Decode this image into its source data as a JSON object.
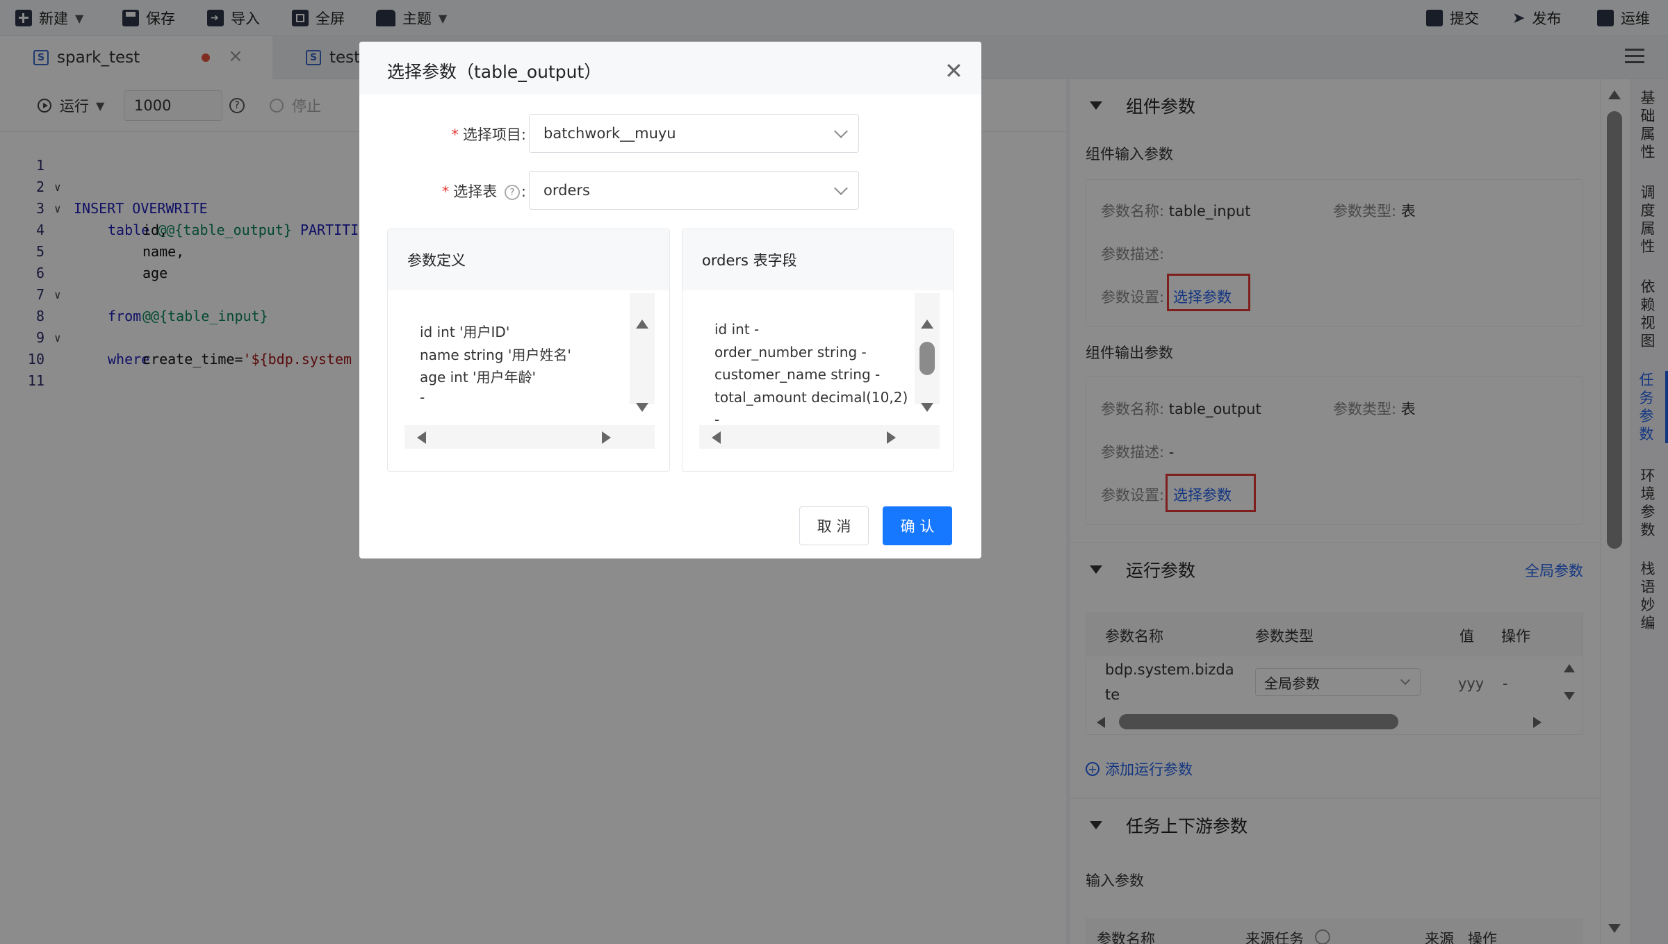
{
  "toolbar": {
    "new": "新建",
    "save": "保存",
    "import": "导入",
    "fullscreen": "全屏",
    "theme": "主题",
    "submit": "提交",
    "publish": "发布",
    "ops": "运维"
  },
  "tabs": [
    {
      "label": "spark_test"
    },
    {
      "label": "test"
    }
  ],
  "editor_toolbar": {
    "run": "运行",
    "limit": "1000",
    "stop": "停止"
  },
  "code": {
    "lines": [
      {
        "no": "1",
        "text": "INSERT OVERWRITE"
      },
      {
        "no": "2",
        "a": "table ",
        "b": "@@{table_output}",
        "c": " PARTITI"
      },
      {
        "no": "3",
        "text": "id,"
      },
      {
        "no": "4",
        "text": "name,"
      },
      {
        "no": "5",
        "text": "age"
      },
      {
        "no": "6",
        "text": "from"
      },
      {
        "no": "7",
        "text": "@@{table_input}"
      },
      {
        "no": "8",
        "text": "where"
      },
      {
        "no": "9",
        "a": "create_time=",
        "b": "'${bdp.system"
      },
      {
        "no": "10"
      },
      {
        "no": "11"
      }
    ]
  },
  "right_panel": {
    "component_params": "组件参数",
    "input_params_title": "组件输入参数",
    "input": {
      "name_label": "参数名称:",
      "name_value": "table_input",
      "type_label": "参数类型:",
      "type_value": "表",
      "desc_label": "参数描述:",
      "desc_value": "",
      "setting_label": "参数设置:",
      "setting_link": "选择参数"
    },
    "output_params_title": "组件输出参数",
    "output": {
      "name_label": "参数名称:",
      "name_value": "table_output",
      "type_label": "参数类型:",
      "type_value": "表",
      "desc_label": "参数描述:",
      "desc_value": "-",
      "setting_label": "参数设置:",
      "setting_link": "选择参数"
    },
    "run_params": "运行参数",
    "global_params_link": "全局参数",
    "run_table": {
      "headers": [
        "参数名称",
        "参数类型",
        "值",
        "操作"
      ],
      "row": {
        "name_l1": "bdp.system.bizda",
        "name_l2": "te",
        "type": "全局参数",
        "value": "yyyy",
        "op": "-"
      }
    },
    "add_run_param": "添加运行参数",
    "upstream_params": "任务上下游参数",
    "input_params": "输入参数",
    "upstream_headers": [
      "参数名称",
      "来源任务",
      "来源",
      "操作"
    ]
  },
  "side_nav": [
    "基础属性",
    "调度属性",
    "依赖视图",
    "任务参数",
    "环境参数",
    "栈语妙编"
  ],
  "modal": {
    "title": "选择参数（table_output）",
    "project_label": "选择项目:",
    "project_value": "batchwork__muyu",
    "table_label": "选择表",
    "table_value": "orders",
    "left_box": {
      "title": "参数定义",
      "lines": [
        "id int '用户ID'",
        "name string '用户姓名'",
        "age int '用户年龄'",
        "-"
      ]
    },
    "right_box": {
      "title": "orders 表字段",
      "lines": [
        "id int -",
        "order_number string -",
        "customer_name string -",
        "total_amount decimal(10,2)",
        "-"
      ]
    },
    "cancel": "取 消",
    "confirm": "确 认"
  },
  "colors": {
    "accent": "#1677ff",
    "highlight_box": "#e53935",
    "keyword": "#1c1cb8",
    "string": "#a31515",
    "variable": "#098658"
  }
}
